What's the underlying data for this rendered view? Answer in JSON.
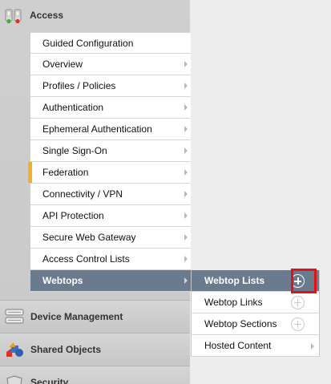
{
  "nav": {
    "access": {
      "label": "Access",
      "icon": "access-booth-icon"
    },
    "submenu": [
      {
        "label": "Guided Configuration",
        "has_arrow": false
      },
      {
        "label": "Overview",
        "has_arrow": true
      },
      {
        "label": "Profiles / Policies",
        "has_arrow": true
      },
      {
        "label": "Authentication",
        "has_arrow": true
      },
      {
        "label": "Ephemeral Authentication",
        "has_arrow": true
      },
      {
        "label": "Single Sign-On",
        "has_arrow": true
      },
      {
        "label": "Federation",
        "has_arrow": true,
        "marked": true
      },
      {
        "label": "Connectivity / VPN",
        "has_arrow": true
      },
      {
        "label": "API Protection",
        "has_arrow": true
      },
      {
        "label": "Secure Web Gateway",
        "has_arrow": true
      },
      {
        "label": "Access Control Lists",
        "has_arrow": true
      },
      {
        "label": "Webtops",
        "has_arrow": true,
        "active": true
      }
    ],
    "flyout": [
      {
        "label": "Webtop Lists",
        "action": "plus-circle-icon",
        "active": true,
        "highlighted": true
      },
      {
        "label": "Webtop Links",
        "action": "plus-circle-icon"
      },
      {
        "label": "Webtop Sections",
        "action": "plus-circle-icon"
      },
      {
        "label": "Hosted Content",
        "action": "chevron-right-icon"
      }
    ],
    "sections": [
      {
        "label": "Device Management",
        "icon": "server-icon"
      },
      {
        "label": "Shared Objects",
        "icon": "shared-objects-icon"
      },
      {
        "label": "Security",
        "icon": "shield-icon"
      }
    ]
  },
  "colors": {
    "active_bg": "#6b7b8e",
    "marker": "#f0b12a",
    "highlight_box": "#e3111b"
  }
}
